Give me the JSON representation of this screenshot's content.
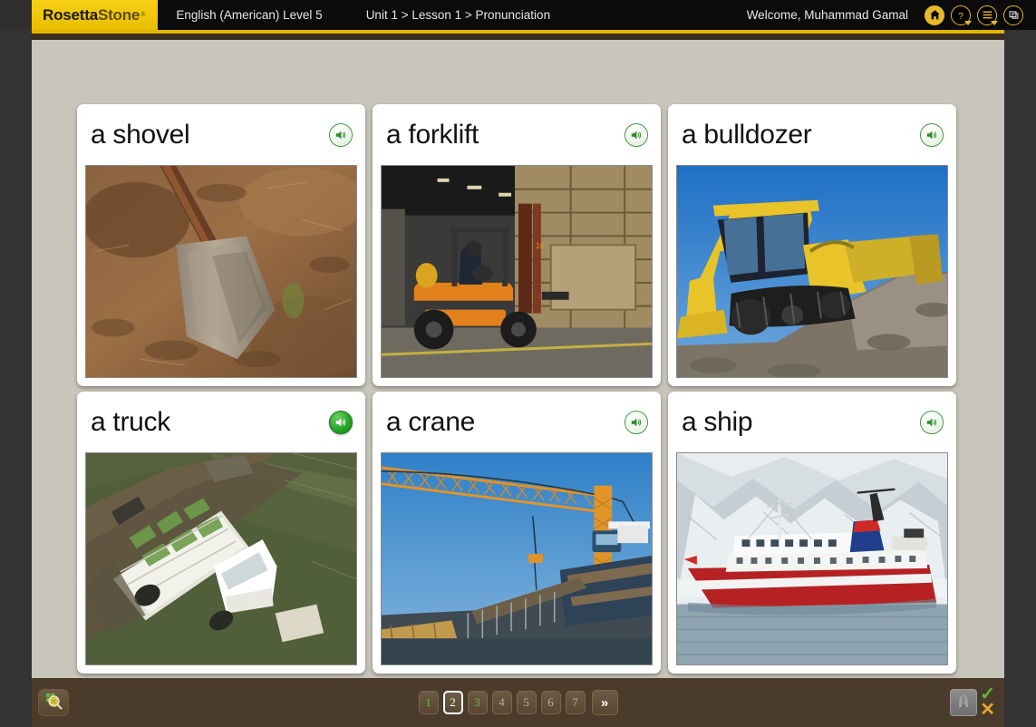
{
  "header": {
    "logo_primary": "Rosetta",
    "logo_secondary": "Stone",
    "logo_tm": "®",
    "course": "English (American) Level 5",
    "breadcrumb": "Unit 1 > Lesson 1 > Pronunciation",
    "welcome": "Welcome, Muhammad Gamal",
    "icons": [
      {
        "name": "home-icon",
        "label": "Home"
      },
      {
        "name": "help-icon",
        "label": "Help"
      },
      {
        "name": "menu-list-icon",
        "label": "Menu"
      },
      {
        "name": "window-icon",
        "label": "Window"
      }
    ]
  },
  "cards": [
    {
      "title": "a shovel",
      "speaker_label": "Play audio",
      "speaker_active": false,
      "photo": "shovel"
    },
    {
      "title": "a forklift",
      "speaker_label": "Play audio",
      "speaker_active": false,
      "photo": "forklift"
    },
    {
      "title": "a bulldozer",
      "speaker_label": "Play audio",
      "speaker_active": false,
      "photo": "bulldozer"
    },
    {
      "title": "a truck",
      "speaker_label": "Play audio",
      "speaker_active": true,
      "photo": "truck"
    },
    {
      "title": "a crane",
      "speaker_label": "Play audio",
      "speaker_active": false,
      "photo": "crane"
    },
    {
      "title": "a ship",
      "speaker_label": "Play audio",
      "speaker_active": false,
      "photo": "ship"
    }
  ],
  "bottom": {
    "zoom_button_label": "Zoom",
    "zoom_icon": "magnifier-grid-icon",
    "pagination": [
      {
        "label": "1",
        "state": "done"
      },
      {
        "label": "2",
        "state": "current"
      },
      {
        "label": "3",
        "state": "done"
      },
      {
        "label": "4",
        "state": "normal"
      },
      {
        "label": "5",
        "state": "normal"
      },
      {
        "label": "6",
        "state": "normal"
      },
      {
        "label": "7",
        "state": "normal"
      }
    ],
    "next_label": "»",
    "mic_icon": "microphone-icon",
    "check_mark": "✓",
    "x_mark": "✕"
  },
  "colors": {
    "brand_gold": "#e8b92c",
    "header_bg": "#0b0b0b",
    "content_bg": "#c8c6ba",
    "bottom_bar_bg": "#4a3b2a",
    "speaker_green": "#27a62a",
    "check_green": "#5bbf2e",
    "x_orange": "#e6a52c"
  }
}
